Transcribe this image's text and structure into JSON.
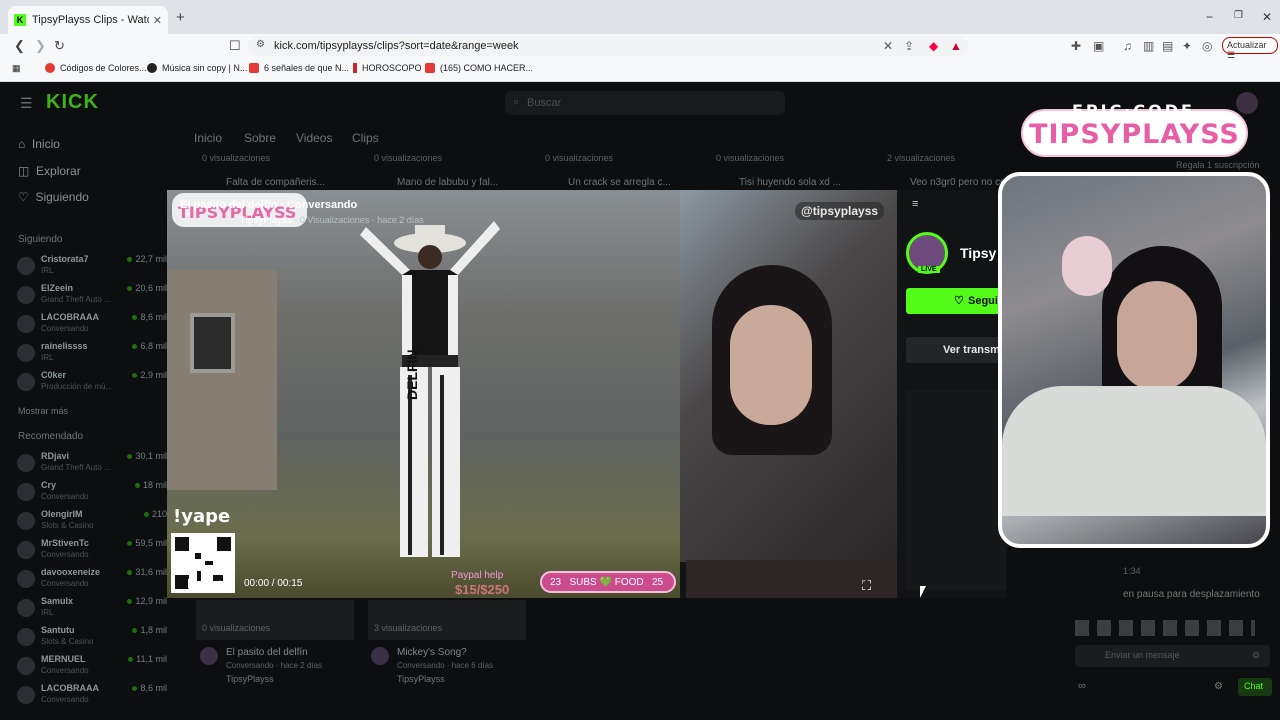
{
  "browser": {
    "tab_title": "TipsyPlayss Clips - Watch Live o",
    "tab_close": "✕",
    "new_tab": "+",
    "win_min": "−",
    "win_max": "❐",
    "win_close": "✕",
    "url": "kick.com/tipsyplayss/clips?sort=date&range=week",
    "update_label": "Actualizar",
    "bookmarks": [
      {
        "label": "Códigos de Colores...",
        "color": "#e53935"
      },
      {
        "label": "Música sin copy | N...",
        "color": "#222222"
      },
      {
        "label": "6 señales de que N...",
        "color": "#e53935"
      },
      {
        "label": "HOROSCOPO",
        "color": "#c62828"
      },
      {
        "label": "(165) COMO HACER...",
        "color": "#e53935"
      }
    ]
  },
  "kick": {
    "logo": "KICK",
    "search_placeholder": "Buscar",
    "nav": {
      "inicio": "Inicio",
      "explorar": "Explorar",
      "siguiendo": "Siguiendo"
    },
    "following_header": "Siguiendo",
    "following": [
      {
        "name": "Cristorata7",
        "cat": "IRL",
        "viewers": "22,7 mil"
      },
      {
        "name": "ElZeein",
        "cat": "Grand Theft Auto ...",
        "viewers": "20,6 mil"
      },
      {
        "name": "LACOBRAAA",
        "cat": "Conversando",
        "viewers": "8,6 mil"
      },
      {
        "name": "rainelissss",
        "cat": "IRL",
        "viewers": "6,8 mil"
      },
      {
        "name": "C0ker",
        "cat": "Producción de mú...",
        "viewers": "2,9 mil"
      }
    ],
    "show_more": "Mostrar más",
    "recommended_header": "Recomendado",
    "recommended": [
      {
        "name": "RDjavi",
        "cat": "Grand Theft Auto ...",
        "viewers": "30,1 mil"
      },
      {
        "name": "Cry",
        "cat": "Conversando",
        "viewers": "18 mil"
      },
      {
        "name": "OlengirIM",
        "cat": "Slots & Casino",
        "viewers": "210"
      },
      {
        "name": "MrStivenTc",
        "cat": "Conversando",
        "viewers": "59,5 mil"
      },
      {
        "name": "davooxeneize",
        "cat": "Conversando",
        "viewers": "31,6 mil"
      },
      {
        "name": "Samulx",
        "cat": "IRL",
        "viewers": "12,9 mil"
      },
      {
        "name": "Santutu",
        "cat": "Slots & Casino",
        "viewers": "1,8 mil"
      },
      {
        "name": "MERNUEL",
        "cat": "Conversando",
        "viewers": "11,1 mil"
      },
      {
        "name": "LACOBRAAA",
        "cat": "Conversando",
        "viewers": "8,6 mil"
      }
    ],
    "profile_tabs": [
      "Inicio",
      "Sobre",
      "Videos",
      "Clips"
    ],
    "clips_row_views": [
      "0 visualizaciones",
      "0 visualizaciones",
      "0 visualizaciones",
      "0 visualizaciones",
      "2 visualizaciones"
    ],
    "clips_row_titles": [
      "Falta de compañeris...",
      "Mano de labubu y fal...",
      "Un crack se arregla c...",
      "Tisi huyendo sola xd ...",
      "Veo n3gr0 pero no co..."
    ],
    "bottom_clips": [
      {
        "views": "0 visualizaciones",
        "title": "El pasito del delfín",
        "meta": "Conversando · hace 2 días",
        "author": "TipsyPlayss"
      },
      {
        "views": "3 visualizaciones",
        "title": "Mickey's Song?",
        "meta": "Conversando · hace 6 días",
        "author": "TipsyPlayss"
      }
    ],
    "gift_text": "Regala 1 suscripción",
    "chat_paused": "en pausa para desplazamiento",
    "chat_placeholder": "Enviar un mensaje",
    "chat_button": "Chat",
    "chat_time": "1:34"
  },
  "player": {
    "title": "El pasito del delfín · Conversando",
    "author": "TipsyPlayss",
    "views": "0 Visualizaciones",
    "ago": "hace 2 días",
    "overlay_logo": "TIPSYPLAYSS",
    "handle": "@tipsyplayss",
    "yape": "!yape",
    "time": "00:00 / 00:15",
    "paypal": "Paypal help",
    "money": "$15/$250",
    "subs_left": "23",
    "subs_text": "SUBS 💚 FOOD",
    "subs_right": "25",
    "delfin": "DELFIN"
  },
  "channel": {
    "name": "Tipsy",
    "live": "LIVE",
    "follow": "Segui",
    "transmit": "Ver transm"
  },
  "overlay": {
    "epic": "EPIC·CODE",
    "brand": "TIPSYPLAYSS"
  }
}
